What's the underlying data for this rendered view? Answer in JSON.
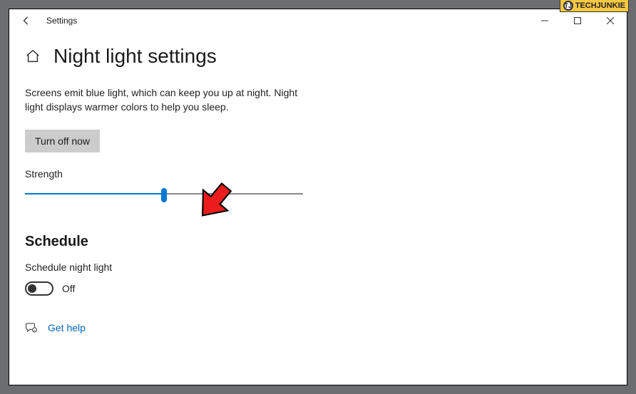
{
  "titlebar": {
    "app_title": "Settings"
  },
  "page": {
    "title": "Night light settings",
    "description": "Screens emit blue light, which can keep you up at night. Night light displays warmer colors to help you sleep.",
    "action_button_label": "Turn off now",
    "strength_label": "Strength",
    "strength_value_percent": 50
  },
  "schedule": {
    "header": "Schedule",
    "subtext": "Schedule night light",
    "toggle_state_label": "Off"
  },
  "help": {
    "link_label": "Get help"
  },
  "watermark": {
    "text": "TECHJUNKIE",
    "badge": "TJ"
  }
}
